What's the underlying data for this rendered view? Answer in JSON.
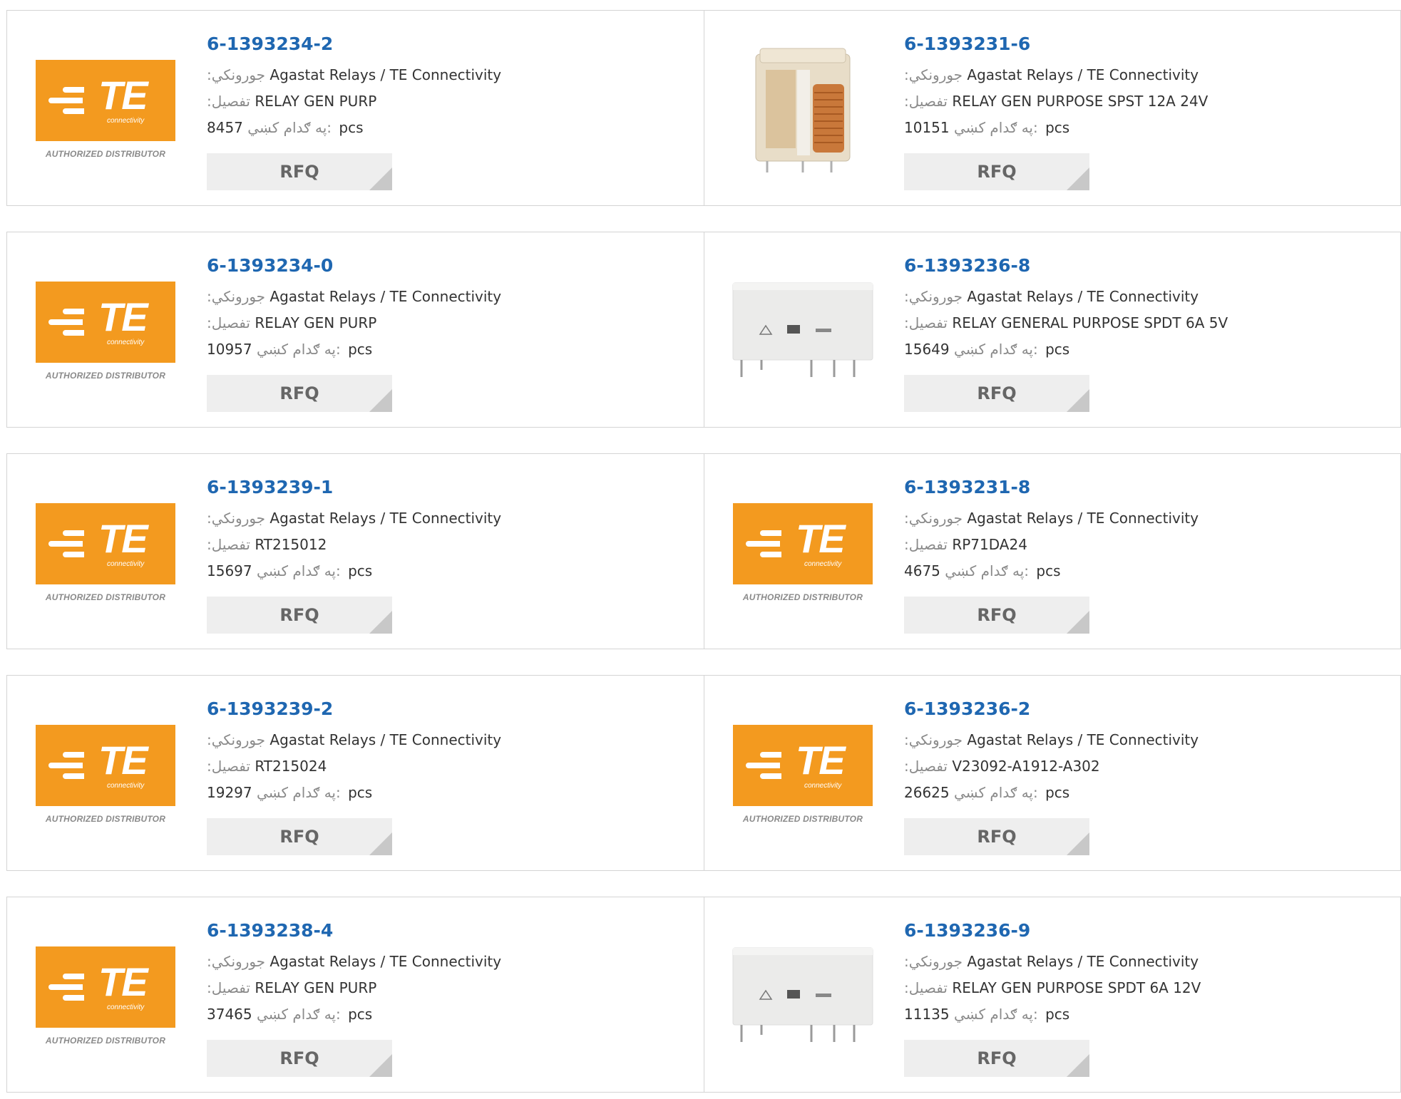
{
  "colors": {
    "link": "#1f67b1",
    "te_orange": "#f39a1f",
    "label_gray": "#8a8a8a",
    "button_bg": "#eeeeee"
  },
  "rows": [
    {
      "left": {
        "part": "6-1393234-2",
        "manufacturer_label": ":جورونکي",
        "manufacturer": "Agastat Relays / TE Connectivity",
        "detail_label": ":تفصيل",
        "detail": "RELAY GEN PURP",
        "stock": "8457",
        "stock_label": "په ګدام کښي:",
        "unit": "pcs",
        "rfq": "RFQ",
        "image": "te-logo"
      },
      "right": {
        "part": "6-1393231-6",
        "manufacturer_label": ":جورونکي",
        "manufacturer": "Agastat Relays / TE Connectivity",
        "detail_label": ":تفصيل",
        "detail": "RELAY GEN PURPOSE SPST 12A 24V",
        "stock": "10151",
        "stock_label": "په ګدام کښي:",
        "unit": "pcs",
        "rfq": "RFQ",
        "image": "relay-clear"
      }
    },
    {
      "left": {
        "part": "6-1393234-0",
        "manufacturer_label": ":جورونکي",
        "manufacturer": "Agastat Relays / TE Connectivity",
        "detail_label": ":تفصيل",
        "detail": "RELAY GEN PURP",
        "stock": "10957",
        "stock_label": "په ګدام کښي:",
        "unit": "pcs",
        "rfq": "RFQ",
        "image": "te-logo"
      },
      "right": {
        "part": "6-1393236-8",
        "manufacturer_label": ":جورونکي",
        "manufacturer": "Agastat Relays / TE Connectivity",
        "detail_label": ":تفصيل",
        "detail": "RELAY GENERAL PURPOSE SPDT 6A 5V",
        "stock": "15649",
        "stock_label": "په ګدام کښي:",
        "unit": "pcs",
        "rfq": "RFQ",
        "image": "relay-white"
      }
    },
    {
      "left": {
        "part": "6-1393239-1",
        "manufacturer_label": ":جورونکي",
        "manufacturer": "Agastat Relays / TE Connectivity",
        "detail_label": ":تفصيل",
        "detail": "RT215012",
        "stock": "15697",
        "stock_label": "په ګدام کښي:",
        "unit": "pcs",
        "rfq": "RFQ",
        "image": "te-logo"
      },
      "right": {
        "part": "6-1393231-8",
        "manufacturer_label": ":جورونکي",
        "manufacturer": "Agastat Relays / TE Connectivity",
        "detail_label": ":تفصيل",
        "detail": "RP71DA24",
        "stock": "4675",
        "stock_label": "په ګدام کښي:",
        "unit": "pcs",
        "rfq": "RFQ",
        "image": "te-logo"
      }
    },
    {
      "left": {
        "part": "6-1393239-2",
        "manufacturer_label": ":جورونکي",
        "manufacturer": "Agastat Relays / TE Connectivity",
        "detail_label": ":تفصيل",
        "detail": "RT215024",
        "stock": "19297",
        "stock_label": "په ګدام کښي:",
        "unit": "pcs",
        "rfq": "RFQ",
        "image": "te-logo"
      },
      "right": {
        "part": "6-1393236-2",
        "manufacturer_label": ":جورونکي",
        "manufacturer": "Agastat Relays / TE Connectivity",
        "detail_label": ":تفصيل",
        "detail": "V23092-A1912-A302",
        "stock": "26625",
        "stock_label": "په ګدام کښي:",
        "unit": "pcs",
        "rfq": "RFQ",
        "image": "te-logo"
      }
    },
    {
      "left": {
        "part": "6-1393238-4",
        "manufacturer_label": ":جورونکي",
        "manufacturer": "Agastat Relays / TE Connectivity",
        "detail_label": ":تفصيل",
        "detail": "RELAY GEN PURP",
        "stock": "37465",
        "stock_label": "په ګدام کښي:",
        "unit": "pcs",
        "rfq": "RFQ",
        "image": "te-logo"
      },
      "right": {
        "part": "6-1393236-9",
        "manufacturer_label": ":جورونکي",
        "manufacturer": "Agastat Relays / TE Connectivity",
        "detail_label": ":تفصيل",
        "detail": "RELAY GEN PURPOSE SPDT 6A 12V",
        "stock": "11135",
        "stock_label": "په ګدام کښي:",
        "unit": "pcs",
        "rfq": "RFQ",
        "image": "relay-white"
      }
    }
  ],
  "te_logo": {
    "letters": "TE",
    "sub": "connectivity",
    "caption": "AUTHORIZED DISTRIBUTOR"
  }
}
